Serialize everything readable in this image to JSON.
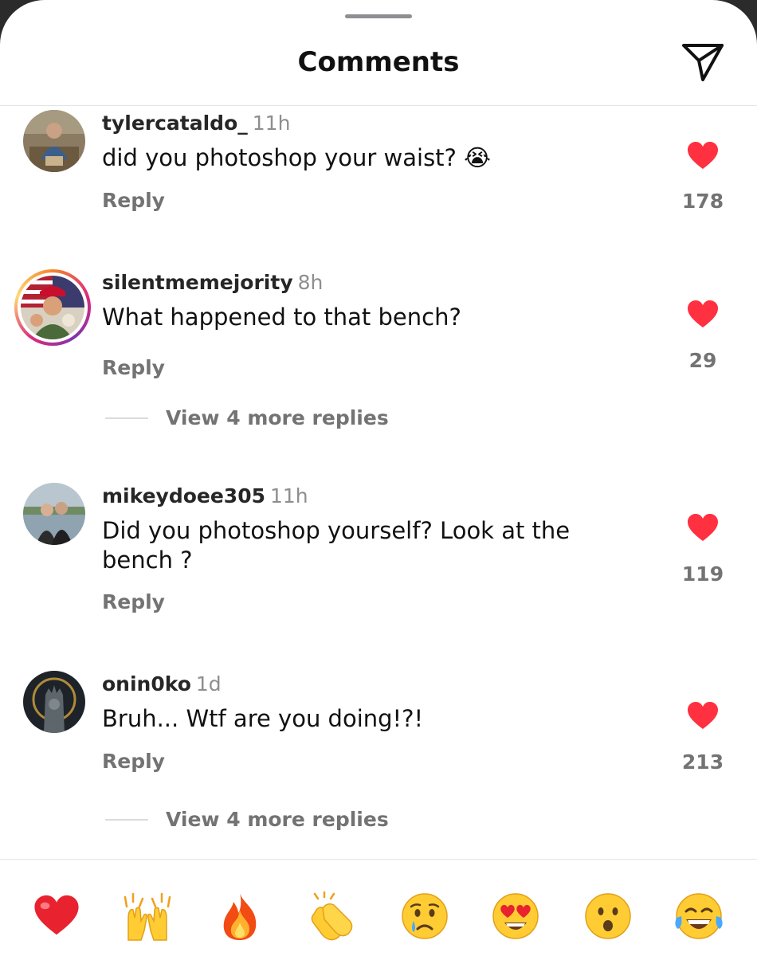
{
  "header": {
    "title": "Comments"
  },
  "comments": [
    {
      "username": "tylercataldo_",
      "time": "11h",
      "text": "did you photoshop your waist? 😭",
      "reply_label": "Reply",
      "likes": "178"
    },
    {
      "username": "silentmemejority",
      "time": "8h",
      "text": "What happened to that bench?",
      "reply_label": "Reply",
      "likes": "29",
      "more_replies": "View 4 more replies"
    },
    {
      "username": "mikeydoee305",
      "time": "11h",
      "text": "Did you photoshop yourself? Look at the bench ?",
      "reply_label": "Reply",
      "likes": "119"
    },
    {
      "username": "onin0ko",
      "time": "1d",
      "text": "Bruh... Wtf are you doing!?!",
      "reply_label": "Reply",
      "likes": "213",
      "more_replies": "View 4 more replies"
    }
  ],
  "reactions": [
    "red-heart",
    "raising-hands",
    "fire",
    "clapping-hands",
    "sad-face",
    "heart-eyes",
    "surprised-face",
    "tears-of-joy"
  ],
  "colors": {
    "like_red": "#ff3040",
    "muted_text": "#737373",
    "accent": "#dd2a7b"
  }
}
